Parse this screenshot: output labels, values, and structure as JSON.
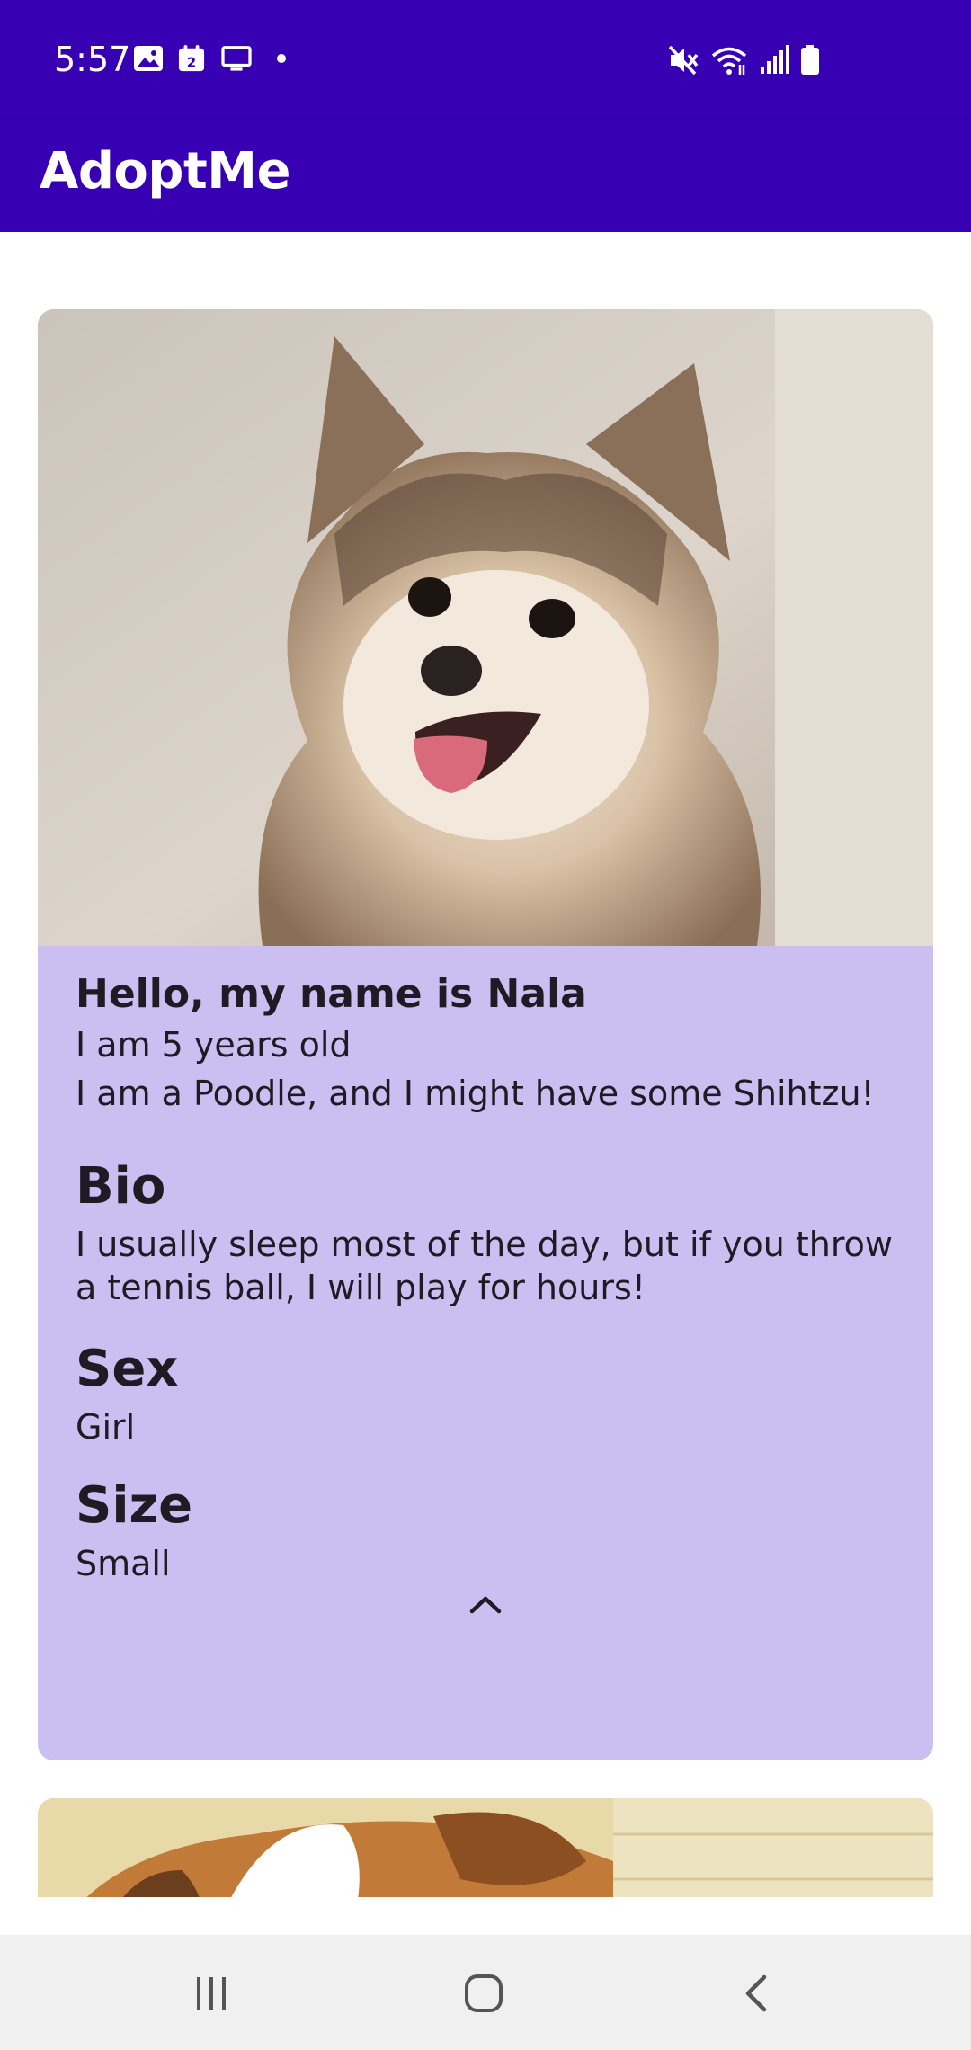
{
  "status_bar": {
    "time": "5:57",
    "left_icons": [
      "gallery-icon",
      "calendar-icon",
      "cast-screen-icon",
      "notification-dot-icon"
    ],
    "calendar_day": "2",
    "right_icons": [
      "mute-icon",
      "wifi-icon",
      "signal-icon",
      "battery-icon"
    ]
  },
  "app_bar": {
    "title": "AdoptMe"
  },
  "pets": [
    {
      "greeting": "Hello, my name is Nala",
      "age": "I am 5 years old",
      "breed": "I am a Poodle, and I might have some Shihtzu!",
      "bio_heading": "Bio",
      "bio": "I usually sleep most of the day, but if you throw a tennis ball, I will play for hours!",
      "sex_heading": "Sex",
      "sex": "Girl",
      "size_heading": "Size",
      "size": "Small",
      "expanded": true,
      "toggle_icon": "chevron-up-icon"
    }
  ],
  "nav_bar": {
    "icons": [
      "recent-apps-icon",
      "home-icon",
      "back-icon"
    ]
  },
  "colors": {
    "primary": "#3700b3",
    "card_background": "#cbbff2",
    "text": "#1f1b24",
    "nav_background": "#f0f0f0"
  }
}
